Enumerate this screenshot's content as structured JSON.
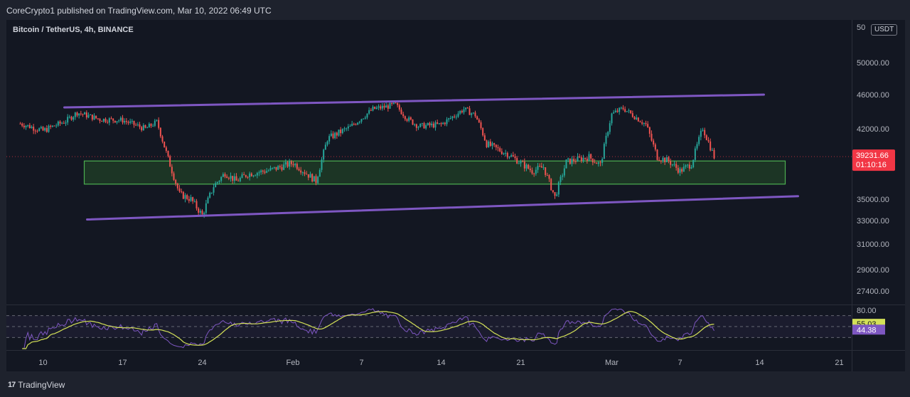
{
  "header": {
    "publisher_line": "CoreCrypto1 published on TradingView.com, Mar 10, 2022 06:49 UTC"
  },
  "chart": {
    "symbol_line": "Bitcoin / TetherUS, 4h, BINANCE",
    "currency": "USDT",
    "price_scale_top_label": "5⁠⁠0",
    "price_ticks": [
      "50000.00",
      "46000.00",
      "42000.00",
      "35000.00",
      "33000.00",
      "31000.00",
      "29000.00",
      "27400.00"
    ],
    "current_price": "39231.66",
    "countdown": "01:10:16",
    "time_ticks": [
      "10",
      "17",
      "24",
      "Feb",
      "7",
      "14",
      "21",
      "Mar",
      "7",
      "14",
      "21"
    ]
  },
  "indicator": {
    "ticks": [
      "80.00"
    ],
    "rsi_value": "44.38",
    "rsi_ma_value": "55.03"
  },
  "footer": {
    "logo_text": "TradingView",
    "logo_glyph": "17"
  },
  "colors": {
    "background": "#131722",
    "up_candle": "#26a69a",
    "down_candle": "#ef5350",
    "channel_line": "#7e57c2",
    "zone_fill": "#1e3b26",
    "zone_border": "#4caf50",
    "rsi_line": "#7e57c2",
    "rsi_ma_line": "#d4e157",
    "price_tag": "#f23645"
  },
  "chart_data": {
    "type": "candlestick",
    "interval": "4h",
    "x_axis": [
      "10",
      "17",
      "24",
      "Feb",
      "7",
      "14",
      "21",
      "Mar",
      "7",
      "14",
      "21"
    ],
    "price_range": [
      27400,
      51000
    ],
    "path_points": [
      [
        "Jan 8",
        42600
      ],
      [
        "Jan 10",
        41800
      ],
      [
        "Jan 12",
        42900
      ],
      [
        "Jan 13",
        43900
      ],
      [
        "Jan 15",
        43100
      ],
      [
        "Jan 17",
        43000
      ],
      [
        "Jan 19",
        42000
      ],
      [
        "Jan 20",
        42800
      ],
      [
        "Jan 21",
        39000
      ],
      [
        "Jan 22",
        35500
      ],
      [
        "Jan 23",
        35000
      ],
      [
        "Jan 24",
        33500
      ],
      [
        "Jan 25",
        36300
      ],
      [
        "Jan 26",
        37600
      ],
      [
        "Jan 27",
        36800
      ],
      [
        "Jan 28",
        37500
      ],
      [
        "Jan 30",
        37900
      ],
      [
        "Feb 1",
        38600
      ],
      [
        "Feb 3",
        36800
      ],
      [
        "Feb 4",
        41000
      ],
      [
        "Feb 6",
        42200
      ],
      [
        "Feb 8",
        44300
      ],
      [
        "Feb 10",
        44800
      ],
      [
        "Feb 11",
        43200
      ],
      [
        "Feb 12",
        42300
      ],
      [
        "Feb 14",
        42500
      ],
      [
        "Feb 16",
        44300
      ],
      [
        "Feb 17",
        43600
      ],
      [
        "Feb 18",
        40500
      ],
      [
        "Feb 20",
        39400
      ],
      [
        "Feb 22",
        37800
      ],
      [
        "Feb 23",
        38200
      ],
      [
        "Feb 24",
        35200
      ],
      [
        "Feb 25",
        38700
      ],
      [
        "Feb 27",
        39200
      ],
      [
        "Feb 28",
        38400
      ],
      [
        "Mar 1",
        43700
      ],
      [
        "Mar 2",
        44400
      ],
      [
        "Mar 4",
        42500
      ],
      [
        "Mar 5",
        39200
      ],
      [
        "Mar 6",
        38800
      ],
      [
        "Mar 7",
        37800
      ],
      [
        "Mar 8",
        38500
      ],
      [
        "Mar 9",
        42100
      ],
      [
        "Mar 10",
        39232
      ]
    ],
    "annotations": [
      {
        "kind": "channel-line",
        "from": [
          "Jan 12",
          44500
        ],
        "to": [
          "Mar 14",
          46000
        ]
      },
      {
        "kind": "channel-line",
        "from": [
          "Jan 14",
          33100
        ],
        "to": [
          "Mar 17",
          35300
        ]
      },
      {
        "kind": "zone",
        "from_date": "Jan 13",
        "to_date": "Mar 16",
        "low": 36500,
        "high": 38800
      }
    ],
    "rsi": {
      "period": 14,
      "upper_band": 70,
      "lower_band": 30,
      "ylim": [
        20,
        80
      ],
      "last_rsi": 44.38,
      "last_ma": 55.03
    }
  }
}
